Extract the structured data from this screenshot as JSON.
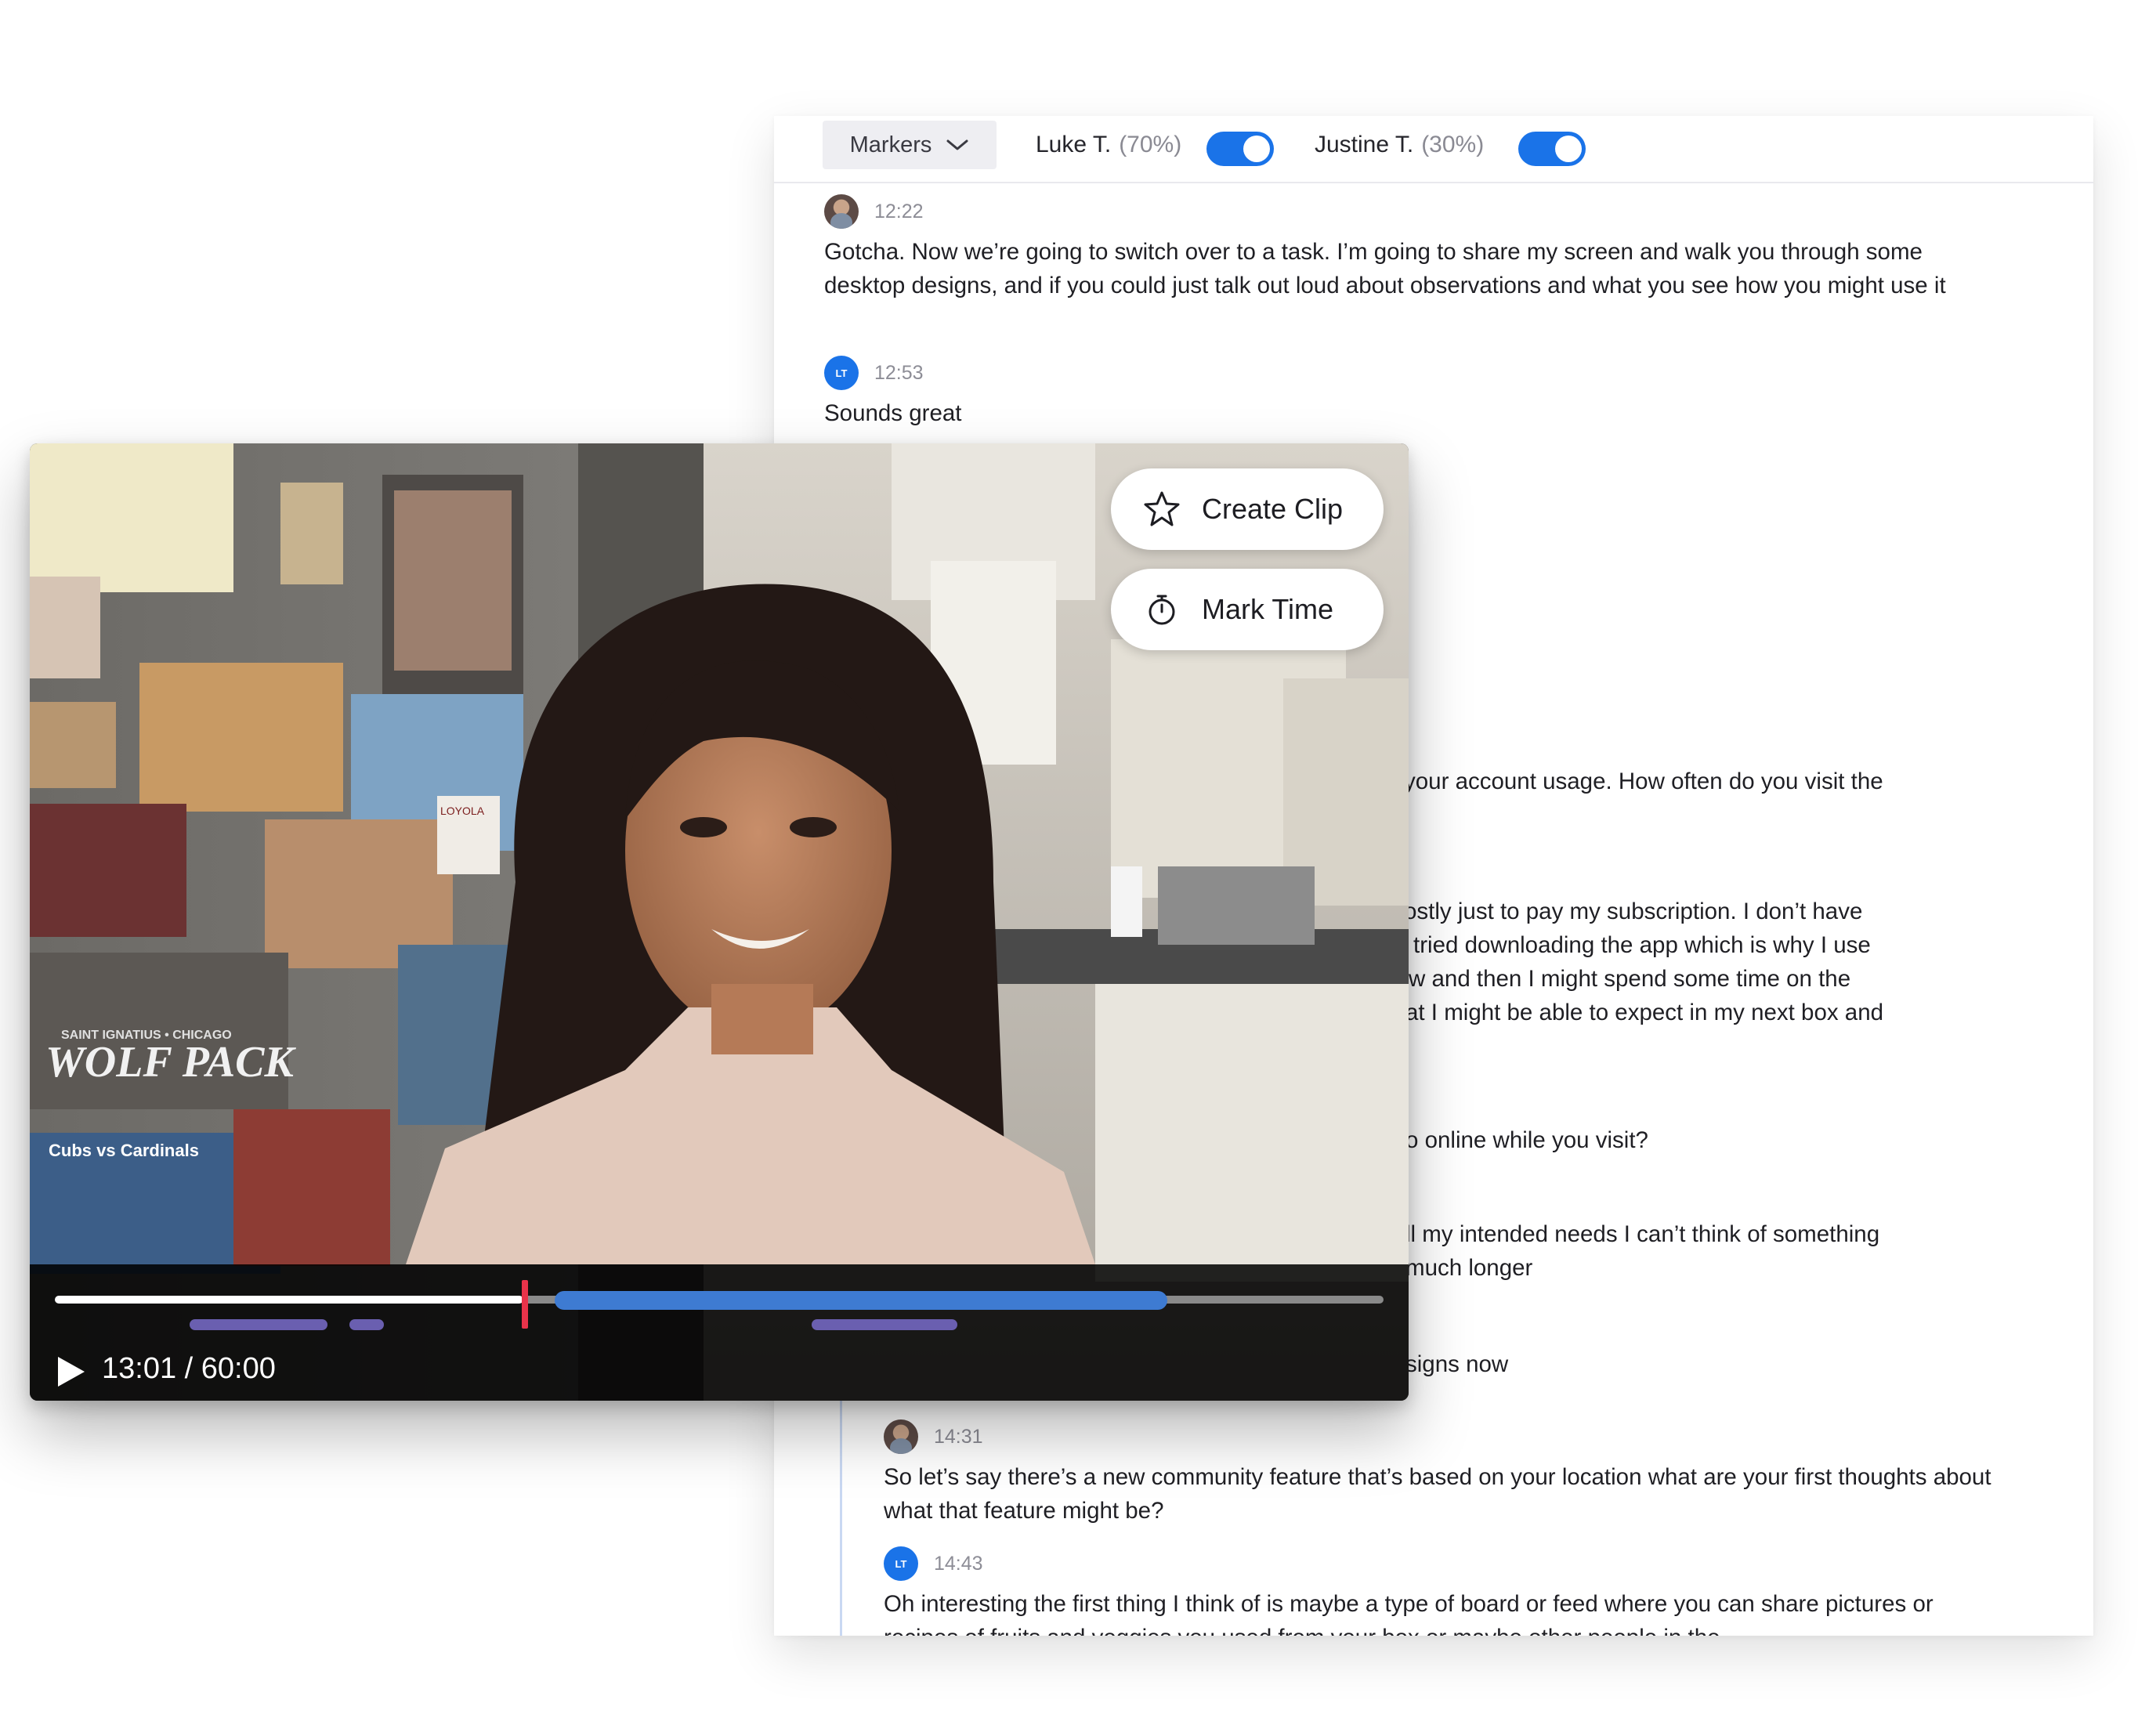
{
  "toolbar": {
    "markers_label": "Markers",
    "speakers": [
      {
        "name": "Luke T.",
        "percent": "(70%)",
        "enabled": true
      },
      {
        "name": "Justine T.",
        "percent": "(30%)",
        "enabled": true
      }
    ]
  },
  "transcript": {
    "entries": [
      {
        "time": "12:22",
        "speaker_avatar": "photo",
        "text": "Gotcha. Now we’re going to switch over to a task. I’m going to share my screen and walk you through some desktop designs, and if you could just talk out loud about observations and what you see how you might use it"
      },
      {
        "time": "12:53",
        "speaker_avatar": "LT",
        "text": "Sounds great"
      },
      {
        "time": "14:31",
        "speaker_avatar": "photo",
        "text": "So let’s say there’s a new community feature that’s based on your location what are your first thoughts about what that feature might be?"
      },
      {
        "time": "14:43",
        "speaker_avatar": "LT",
        "text": "Oh interesting the first thing I think of is maybe a type of board or feed where you can share pictures or recipes of fruits and veggies you used from your box or maybe other people in the"
      }
    ],
    "partial_lines": [
      "your account usage. How often do you visit the",
      "ostly just to pay my subscription. I don’t have",
      "tried downloading the app which is why I use",
      "w and then I might spend some time on the",
      "at I might be able to expect in my next box and",
      "o online while you visit?",
      "ll my intended needs I can’t think of something",
      "much longer",
      "signs now"
    ]
  },
  "video": {
    "buttons": {
      "create_clip": "Create Clip",
      "mark_time": "Mark Time"
    },
    "timecode": "13:01 / 60:00",
    "progress": 0.217,
    "scene_text": {
      "wolfpack": "WOLF PACK",
      "wolfpack_sub": "SAINT IGNATIUS • CHICAGO",
      "loyola": "LOYOLA",
      "cubs": "Cubs vs Cardinals"
    }
  },
  "colors": {
    "toggle_on": "#1a73e8",
    "clip_range": "#3e7bd2",
    "playhead": "#e8334a",
    "marker": "#6a5fb0"
  }
}
